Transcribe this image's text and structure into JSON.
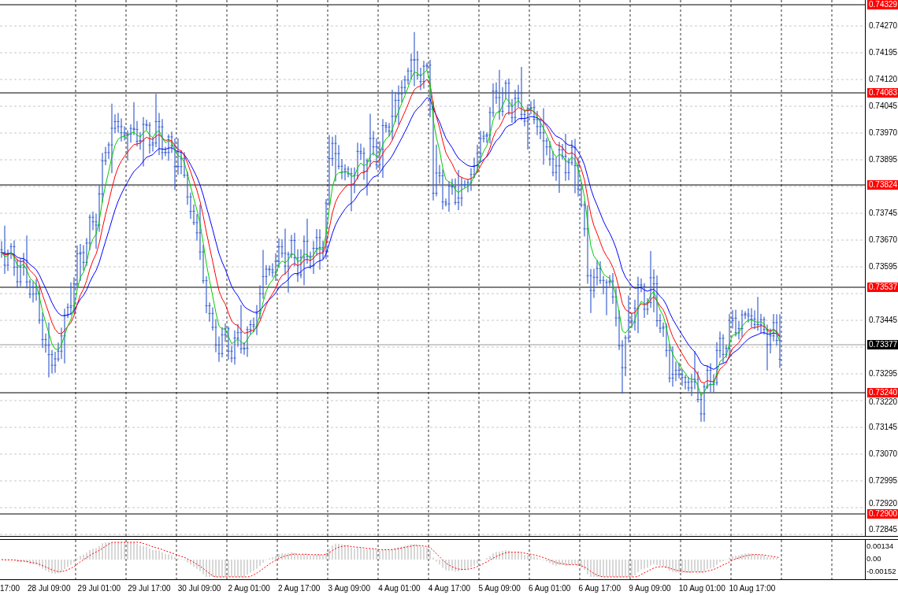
{
  "price_axis": {
    "ticks": [
      "0.74270",
      "0.74195",
      "0.74120",
      "0.74045",
      "0.73970",
      "0.73895",
      "0.73745",
      "0.73670",
      "0.73595",
      "0.73445",
      "0.73295",
      "0.73220",
      "0.73145",
      "0.73070",
      "0.72995",
      "0.72920",
      "0.72845"
    ]
  },
  "levels": [
    {
      "label": "0.74329",
      "color": "#ff0000"
    },
    {
      "label": "0.74083",
      "color": "#ff0000"
    },
    {
      "label": "0.73824",
      "color": "#ff0000"
    },
    {
      "label": "0.73537",
      "color": "#ff0000"
    },
    {
      "label": "0.73377",
      "color": "#000000"
    },
    {
      "label": "0.73240",
      "color": "#ff0000"
    },
    {
      "label": "0.72900",
      "color": "#ff0000"
    }
  ],
  "indicator_axis": {
    "ticks": [
      "0.00134",
      "0.00",
      "-0.00152"
    ]
  },
  "time_axis": {
    "labels": [
      "17:00",
      "28 Jul 09:00",
      "29 Jul 01:00",
      "29 Jul 17:00",
      "30 Jul 09:00",
      "2 Aug 01:00",
      "2 Aug 17:00",
      "3 Aug 09:00",
      "4 Aug 01:00",
      "4 Aug 17:00",
      "5 Aug 09:00",
      "6 Aug 01:00",
      "6 Aug 17:00",
      "9 Aug 09:00",
      "10 Aug 01:00",
      "10 Aug 17:00"
    ]
  }
}
